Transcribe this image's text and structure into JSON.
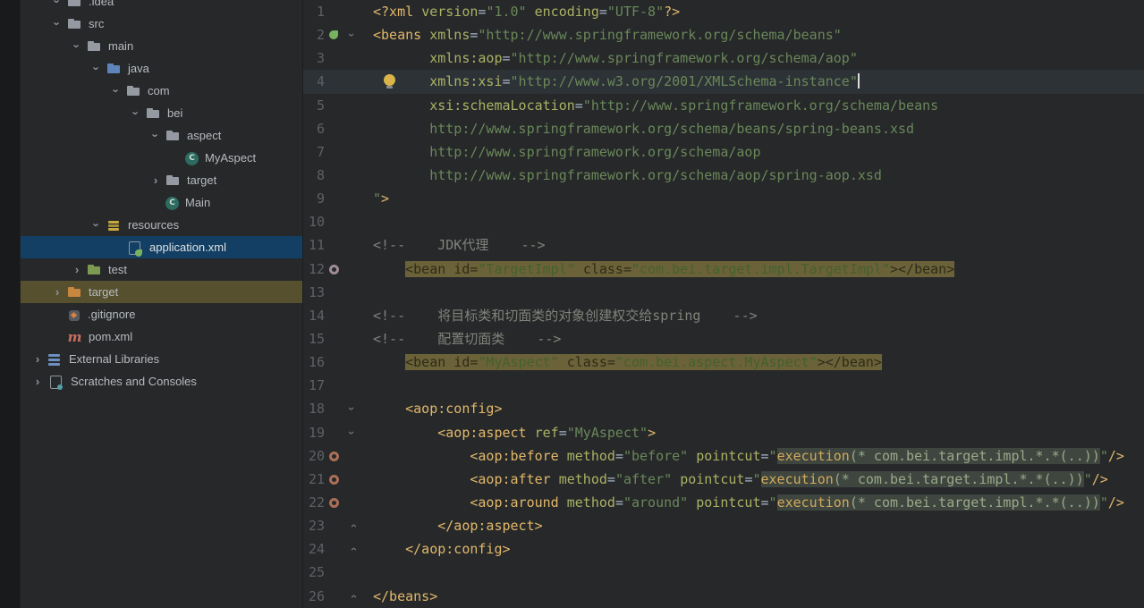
{
  "glyphs": {
    "chevron": "›",
    "class_letter": "C",
    "maven_letter": "m"
  },
  "colors": {
    "selection_blue": "#123f63",
    "excluded_row_tan": "#56502f",
    "search_highlight": "#6b6239",
    "injected_fragment_bg": "#3e463f",
    "string_green": "#6a8759",
    "tag_yellow": "#e2b86a",
    "attribute_olive": "#abb264",
    "comment_gray": "#80837a",
    "editor_bg": "#26282a",
    "current_line_bg": "#2d3237",
    "spring_green": "#77b25f",
    "bulb_yellow": "#d9b44a"
  },
  "project_tree": {
    "items": [
      {
        "label": ".idea",
        "indent": 1,
        "chevron": "down",
        "icon": "folder",
        "partial": true
      },
      {
        "label": "src",
        "indent": 1,
        "chevron": "down",
        "icon": "folder"
      },
      {
        "label": "main",
        "indent": 2,
        "chevron": "down",
        "icon": "folder"
      },
      {
        "label": "java",
        "indent": 3,
        "chevron": "down",
        "icon": "folder-blue"
      },
      {
        "label": "com",
        "indent": 4,
        "chevron": "down",
        "icon": "folder"
      },
      {
        "label": "bei",
        "indent": 5,
        "chevron": "down",
        "icon": "folder"
      },
      {
        "label": "aspect",
        "indent": 6,
        "chevron": "down",
        "icon": "folder"
      },
      {
        "label": "MyAspect",
        "indent": 7,
        "chevron": null,
        "icon": "class"
      },
      {
        "label": "target",
        "indent": 6,
        "chevron": "right",
        "icon": "folder"
      },
      {
        "label": "Main",
        "indent": 6,
        "chevron": null,
        "icon": "class"
      },
      {
        "label": "resources",
        "indent": 3,
        "chevron": "down",
        "icon": "resources"
      },
      {
        "label": "application.xml",
        "indent": 4,
        "chevron": null,
        "icon": "springxml",
        "selected": true
      },
      {
        "label": "test",
        "indent": 2,
        "chevron": "right",
        "icon": "folder-green"
      },
      {
        "label": "target",
        "indent": 1,
        "chevron": "right",
        "icon": "folder-orange",
        "highlighted": true
      },
      {
        "label": ".gitignore",
        "indent": 1,
        "chevron": null,
        "icon": "git"
      },
      {
        "label": "pom.xml",
        "indent": 1,
        "chevron": null,
        "icon": "maven"
      },
      {
        "label": "External Libraries",
        "indent": 0,
        "chevron": "right",
        "icon": "lib"
      },
      {
        "label": "Scratches and Consoles",
        "indent": 0,
        "chevron": "right",
        "icon": "scratch"
      }
    ]
  },
  "editor": {
    "lines": [
      {
        "num": "1",
        "tokens": [
          [
            "t",
            "<?xml "
          ],
          [
            "a",
            "version"
          ],
          [
            "n",
            "="
          ],
          [
            "s",
            "\"1.0\""
          ],
          [
            "n",
            " "
          ],
          [
            "a",
            "encoding"
          ],
          [
            "n",
            "="
          ],
          [
            "s",
            "\"UTF-8\""
          ],
          [
            "t",
            "?>"
          ]
        ]
      },
      {
        "num": "2",
        "icon": "spring",
        "fold": "open",
        "tokens": [
          [
            "t",
            "<beans "
          ],
          [
            "a",
            "xmlns"
          ],
          [
            "n",
            "="
          ],
          [
            "s",
            "\"http://www.springframework.org/schema/beans\""
          ]
        ]
      },
      {
        "num": "3",
        "tokens": [
          [
            "n",
            "       "
          ],
          [
            "a",
            "xmlns:aop"
          ],
          [
            "n",
            "="
          ],
          [
            "s",
            "\"http://www.springframework.org/schema/aop\""
          ]
        ]
      },
      {
        "num": "4",
        "cur": true,
        "bulb": true,
        "caret": true,
        "tokens": [
          [
            "n",
            "       "
          ],
          [
            "a",
            "xmlns:xsi"
          ],
          [
            "n",
            "="
          ],
          [
            "s",
            "\"http://www.w3.org/2001/XMLSchema-instance\""
          ]
        ]
      },
      {
        "num": "5",
        "tokens": [
          [
            "n",
            "       "
          ],
          [
            "a",
            "xsi:schemaLocation"
          ],
          [
            "n",
            "="
          ],
          [
            "s",
            "\"http://www.springframework.org/schema/beans"
          ]
        ]
      },
      {
        "num": "6",
        "tokens": [
          [
            "n",
            "       "
          ],
          [
            "s",
            "http://www.springframework.org/schema/beans/spring-beans.xsd"
          ]
        ]
      },
      {
        "num": "7",
        "tokens": [
          [
            "n",
            "       "
          ],
          [
            "s",
            "http://www.springframework.org/schema/aop"
          ]
        ]
      },
      {
        "num": "8",
        "tokens": [
          [
            "n",
            "       "
          ],
          [
            "s",
            "http://www.springframework.org/schema/aop/spring-aop.xsd"
          ]
        ]
      },
      {
        "num": "9",
        "tokens": [
          [
            "s",
            "\""
          ],
          [
            "t",
            ">"
          ]
        ]
      },
      {
        "num": "10",
        "tokens": []
      },
      {
        "num": "11",
        "tokens": [
          [
            "c",
            "<!--    JDK代理    -->"
          ]
        ]
      },
      {
        "num": "12",
        "icon": "donut2",
        "tokens": [
          [
            "n",
            "    "
          ],
          [
            "ht",
            "<bean "
          ],
          [
            "ha",
            "id"
          ],
          [
            "hn",
            "="
          ],
          [
            "hs",
            "\"TargetImpl\""
          ],
          [
            "hn",
            " "
          ],
          [
            "ha",
            "class"
          ],
          [
            "hn",
            "="
          ],
          [
            "hs",
            "\"com.bei.target.impl.TargetImpl\""
          ],
          [
            "ht",
            "></bean>"
          ]
        ]
      },
      {
        "num": "13",
        "tokens": []
      },
      {
        "num": "14",
        "tokens": [
          [
            "c",
            "<!--    将目标类和切面类的对象创建权交给spring    -->"
          ]
        ]
      },
      {
        "num": "15",
        "tokens": [
          [
            "c",
            "<!--    配置切面类    -->"
          ]
        ]
      },
      {
        "num": "16",
        "tokens": [
          [
            "n",
            "    "
          ],
          [
            "ht",
            "<bean "
          ],
          [
            "ha",
            "id"
          ],
          [
            "hn",
            "="
          ],
          [
            "hs",
            "\"MyAspect\""
          ],
          [
            "hn",
            " "
          ],
          [
            "ha",
            "class"
          ],
          [
            "hn",
            "="
          ],
          [
            "hs",
            "\"com.bei.aspect.MyAspect\""
          ],
          [
            "ht",
            "></bean>"
          ]
        ]
      },
      {
        "num": "17",
        "tokens": []
      },
      {
        "num": "18",
        "fold": "open",
        "tokens": [
          [
            "n",
            "    "
          ],
          [
            "t",
            "<aop:config>"
          ]
        ]
      },
      {
        "num": "19",
        "fold": "open",
        "tokens": [
          [
            "n",
            "        "
          ],
          [
            "t",
            "<aop:aspect "
          ],
          [
            "a",
            "ref"
          ],
          [
            "n",
            "="
          ],
          [
            "s",
            "\"MyAspect\""
          ],
          [
            "t",
            ">"
          ]
        ]
      },
      {
        "num": "20",
        "icon": "donut",
        "tokens": [
          [
            "n",
            "            "
          ],
          [
            "t",
            "<aop:before "
          ],
          [
            "a",
            "method"
          ],
          [
            "n",
            "="
          ],
          [
            "s",
            "\"before\""
          ],
          [
            "n",
            " "
          ],
          [
            "a",
            "pointcut"
          ],
          [
            "n",
            "="
          ],
          [
            "s",
            "\""
          ],
          [
            "ek",
            "execution"
          ],
          [
            "ea",
            "(* com.bei.target.impl.*.*(..))"
          ],
          [
            "s",
            "\""
          ],
          [
            "t",
            "/>"
          ]
        ]
      },
      {
        "num": "21",
        "icon": "donut",
        "tokens": [
          [
            "n",
            "            "
          ],
          [
            "t",
            "<aop:after "
          ],
          [
            "a",
            "method"
          ],
          [
            "n",
            "="
          ],
          [
            "s",
            "\"after\""
          ],
          [
            "n",
            " "
          ],
          [
            "a",
            "pointcut"
          ],
          [
            "n",
            "="
          ],
          [
            "s",
            "\""
          ],
          [
            "ek",
            "execution"
          ],
          [
            "ea",
            "(* com.bei.target.impl.*.*(..))"
          ],
          [
            "s",
            "\""
          ],
          [
            "t",
            "/>"
          ]
        ]
      },
      {
        "num": "22",
        "icon": "donut",
        "tokens": [
          [
            "n",
            "            "
          ],
          [
            "t",
            "<aop:around "
          ],
          [
            "a",
            "method"
          ],
          [
            "n",
            "="
          ],
          [
            "s",
            "\"around\""
          ],
          [
            "n",
            " "
          ],
          [
            "a",
            "pointcut"
          ],
          [
            "n",
            "="
          ],
          [
            "s",
            "\""
          ],
          [
            "ek",
            "execution"
          ],
          [
            "ea",
            "(* com.bei.target.impl.*.*(..))"
          ],
          [
            "s",
            "\""
          ],
          [
            "t",
            "/>"
          ]
        ]
      },
      {
        "num": "23",
        "fold": "close",
        "tokens": [
          [
            "n",
            "        "
          ],
          [
            "t",
            "</aop:aspect>"
          ]
        ]
      },
      {
        "num": "24",
        "fold": "close",
        "tokens": [
          [
            "n",
            "    "
          ],
          [
            "t",
            "</aop:config>"
          ]
        ]
      },
      {
        "num": "25",
        "tokens": []
      },
      {
        "num": "26",
        "fold": "close",
        "tokens": [
          [
            "t",
            "</beans>"
          ]
        ]
      }
    ]
  }
}
